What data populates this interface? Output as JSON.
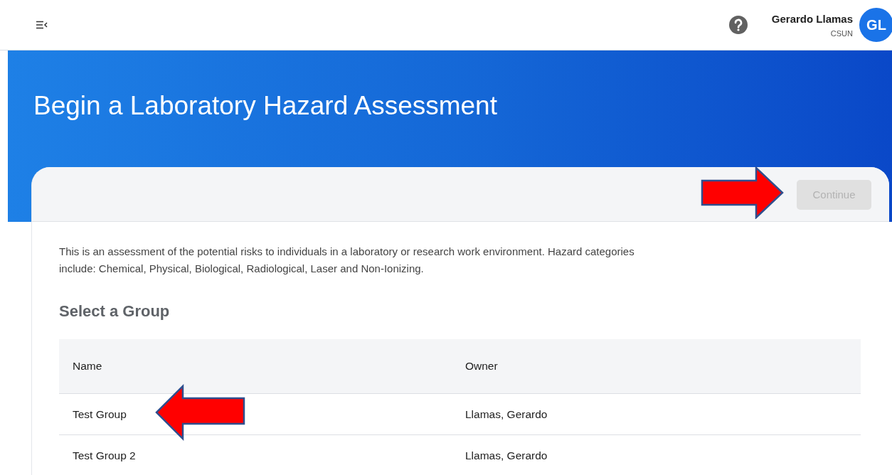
{
  "user": {
    "name": "Gerardo Llamas",
    "organization": "CSUN",
    "initials": "GL"
  },
  "page_title": "Begin a Laboratory Hazard Assessment",
  "continue_button": {
    "label": "Continue",
    "disabled": true,
    "marked_by_arrow": true
  },
  "description": "This is an assessment of the potential risks to individuals in a laboratory or research work environment. Hazard categories include: Chemical, Physical, Biological, Radiological, Laser and Non-Ionizing.",
  "section_title": "Select a Group",
  "table": {
    "columns": [
      "Name",
      "Owner"
    ],
    "rows": [
      {
        "name": "Test Group",
        "owner": "Llamas, Gerardo",
        "marked_by_arrow": true
      },
      {
        "name": "Test Group 2",
        "owner": "Llamas, Gerardo",
        "marked_by_arrow": false
      }
    ]
  }
}
